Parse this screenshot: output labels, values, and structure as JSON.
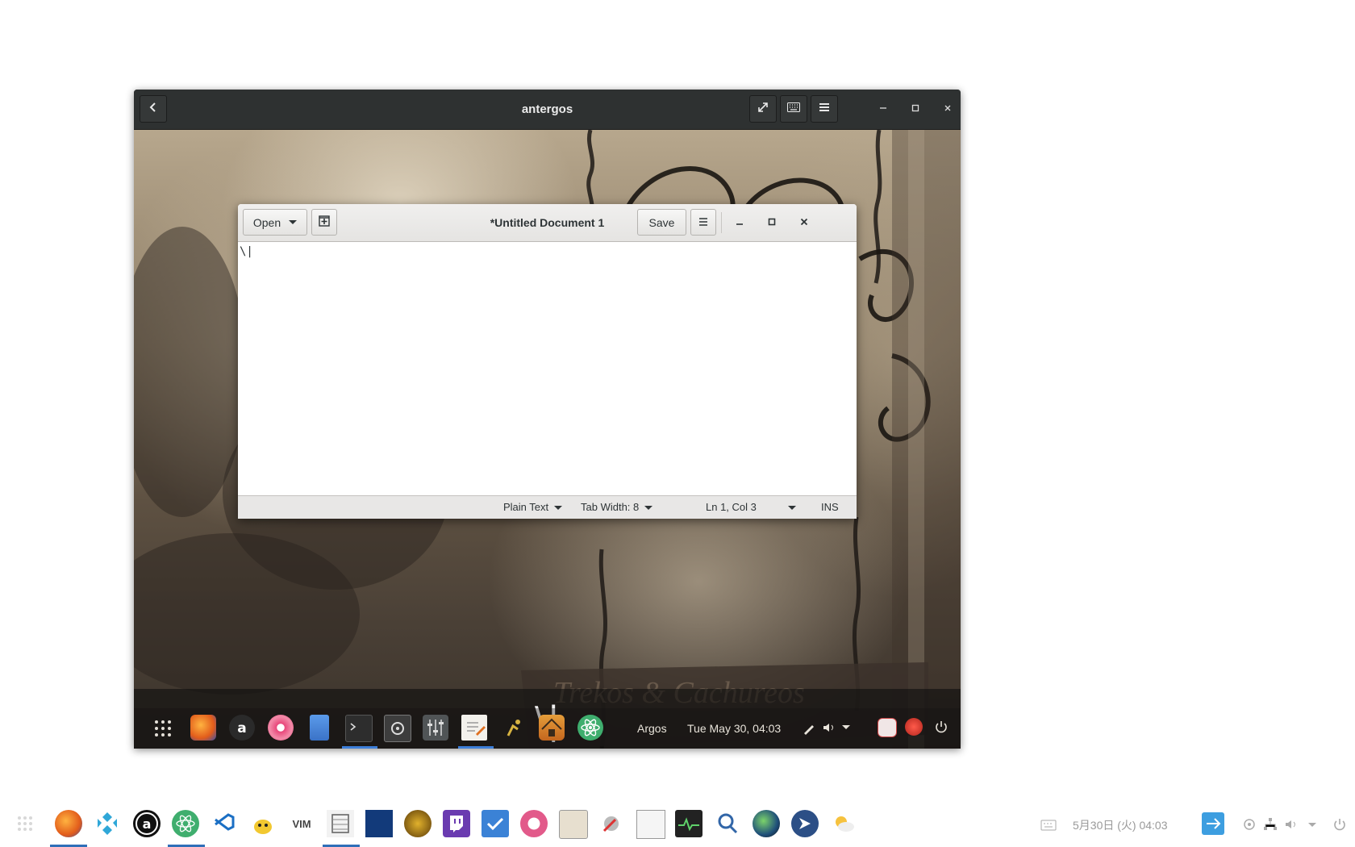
{
  "remote_window": {
    "title": "antergos",
    "buttons": [
      "back",
      "fullscreen",
      "keyboard",
      "menu"
    ]
  },
  "gedit": {
    "open_label": "Open",
    "save_label": "Save",
    "title": "*Untitled Document 1",
    "content": "\\|",
    "status": {
      "language": "Plain Text",
      "tab_width": "Tab Width: 8",
      "position": "Ln 1, Col 3",
      "mode": "INS"
    }
  },
  "osd": {
    "text": "\\|"
  },
  "inner_dock": {
    "apps": [
      "app-grid-icon",
      "firefox-icon",
      "antergos-icon",
      "lollypop-icon",
      "files-icon",
      "terminal-icon",
      "system-settings-icon",
      "tweaks-icon",
      "text-editor-icon",
      "robot-icon",
      "hut-icon",
      "atom-icon"
    ],
    "argos_label": "Argos",
    "clock": "Tue May 30, 04:03"
  },
  "host_taskbar": {
    "apps": [
      "app-grid-icon",
      "firefox-icon",
      "kodi-icon",
      "antergos-icon",
      "atom-icon",
      "vscode-icon",
      "teapot-icon",
      "vim-icon",
      "file-roller-icon",
      "blizzard-icon",
      "wow-icon",
      "twitch-icon",
      "todo-icon",
      "cockatoo-icon",
      "archive-icon",
      "settings-icon",
      "soundboard-icon",
      "system-monitor-icon",
      "search-icon",
      "globe-icon",
      "bird-icon",
      "weather-icon"
    ],
    "clock": "5月30日 (火) 04:03"
  },
  "colors": {
    "accent": "#3d7fd9",
    "header_dark": "#2e3131",
    "header_light": "#e5e4e2"
  }
}
